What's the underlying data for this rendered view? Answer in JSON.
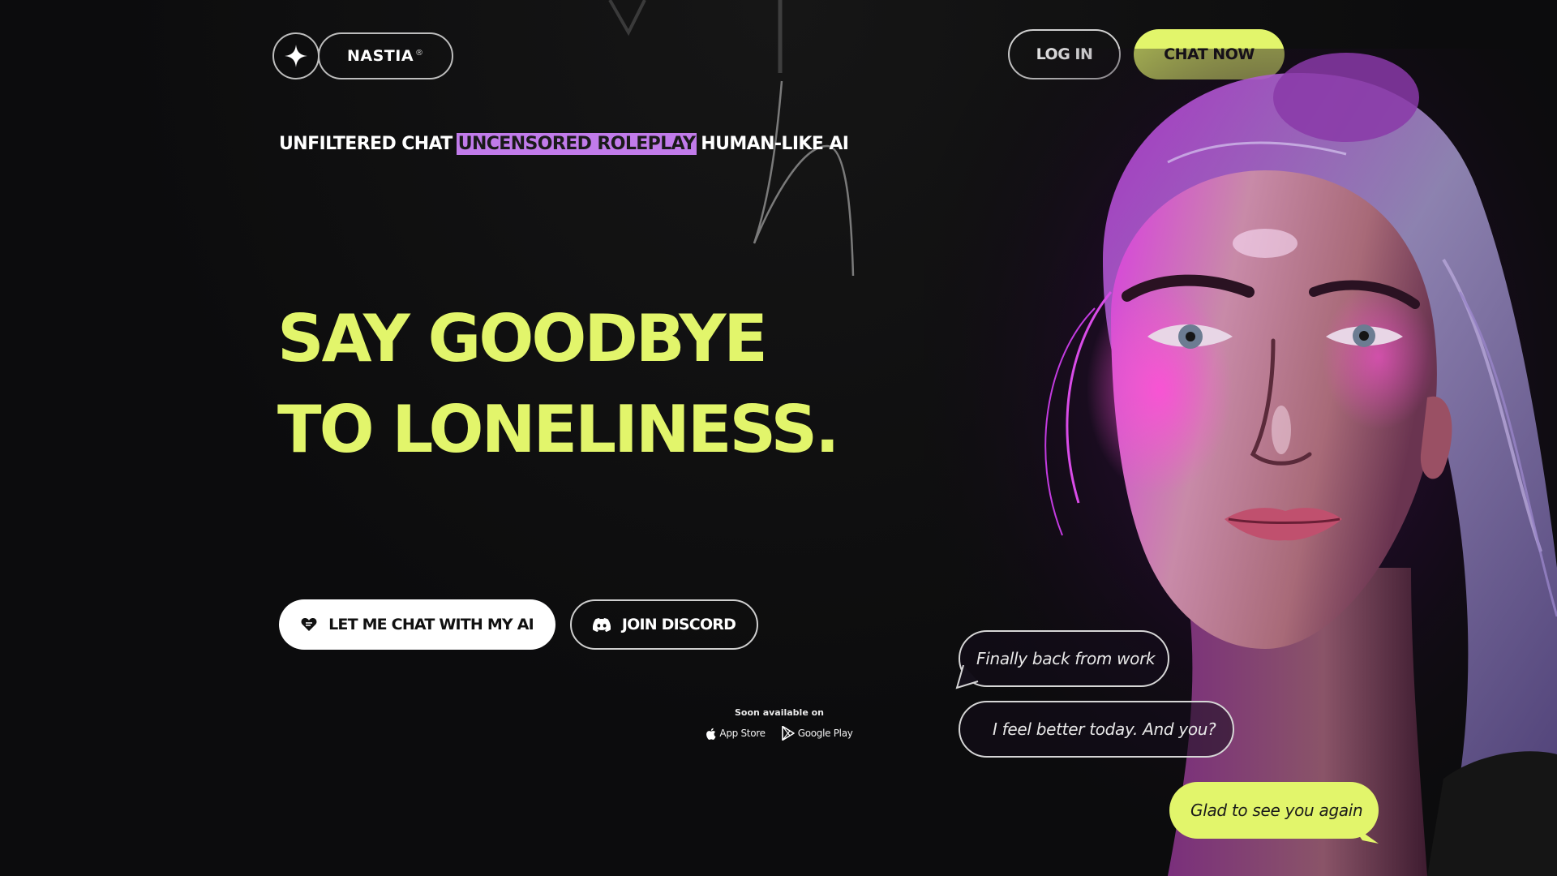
{
  "header": {
    "brand_name": "NASTIA",
    "brand_mark": "®",
    "login_label": "LOG IN",
    "chat_now_label": "CHAT NOW"
  },
  "tagline": {
    "part1": "UNFILTERED CHAT",
    "part2_highlight": "UNCENSORED ROLEPLAY",
    "part3": "HUMAN-LIKE AI"
  },
  "hero": {
    "line1": "SAY GOODBYE",
    "line2": "TO LONELINESS."
  },
  "cta": {
    "primary_label": "LET ME CHAT WITH MY AI",
    "discord_label": "JOIN DISCORD"
  },
  "availability": {
    "soon_label": "Soon available on",
    "app_store": "App Store",
    "google_play": "Google Play"
  },
  "chat": {
    "message_1": "Finally back from work",
    "message_2": "I feel better today. And you?",
    "message_3": "Glad to see you again"
  },
  "colors": {
    "accent_lime": "#e2f56b",
    "highlight_purple": "#c17bea",
    "background": "#0d0d0e"
  },
  "icons": [
    "sparkle-star-icon",
    "heart-chat-icon",
    "discord-icon",
    "apple-icon",
    "google-play-icon"
  ]
}
